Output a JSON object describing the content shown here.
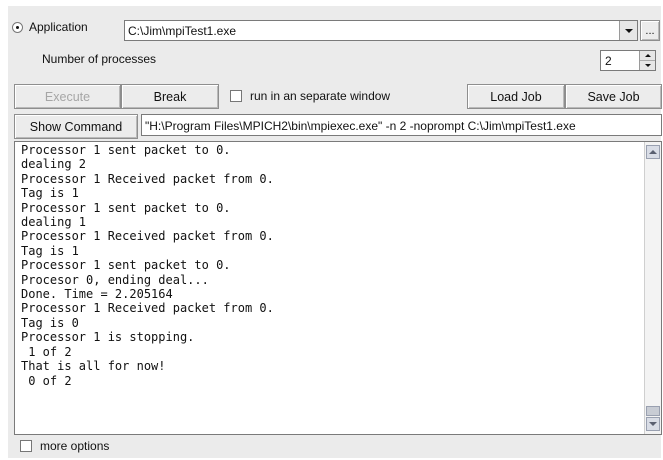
{
  "application": {
    "radio_label": "Application",
    "path": "C:\\Jim\\mpiTest1.exe",
    "browse_label": "..."
  },
  "processes": {
    "label": "Number of processes",
    "value": "2"
  },
  "toolbar": {
    "execute_label": "Execute",
    "break_label": "Break",
    "separate_window_label": "run in an separate window",
    "load_job_label": "Load Job",
    "save_job_label": "Save Job"
  },
  "command": {
    "show_label": "Show Command",
    "text": "\"H:\\Program Files\\MPICH2\\bin\\mpiexec.exe\" -n 2  -noprompt C:\\Jim\\mpiTest1.exe"
  },
  "output": {
    "lines": [
      "Processor 1 sent packet to 0.",
      "dealing 2",
      "Processor 1 Received packet from 0.",
      "Tag is 1",
      "Processor 1 sent packet to 0.",
      "dealing 1",
      "Processor 1 Received packet from 0.",
      "Tag is 1",
      "Processor 1 sent packet to 0.",
      "Procesor 0, ending deal...",
      "Done. Time = 2.205164",
      "Processor 1 Received packet from 0.",
      "Tag is 0",
      "Processor 1 is stopping.",
      " 1 of 2",
      "That is all for now!",
      " 0 of 2"
    ]
  },
  "footer": {
    "more_options_label": "more options"
  }
}
